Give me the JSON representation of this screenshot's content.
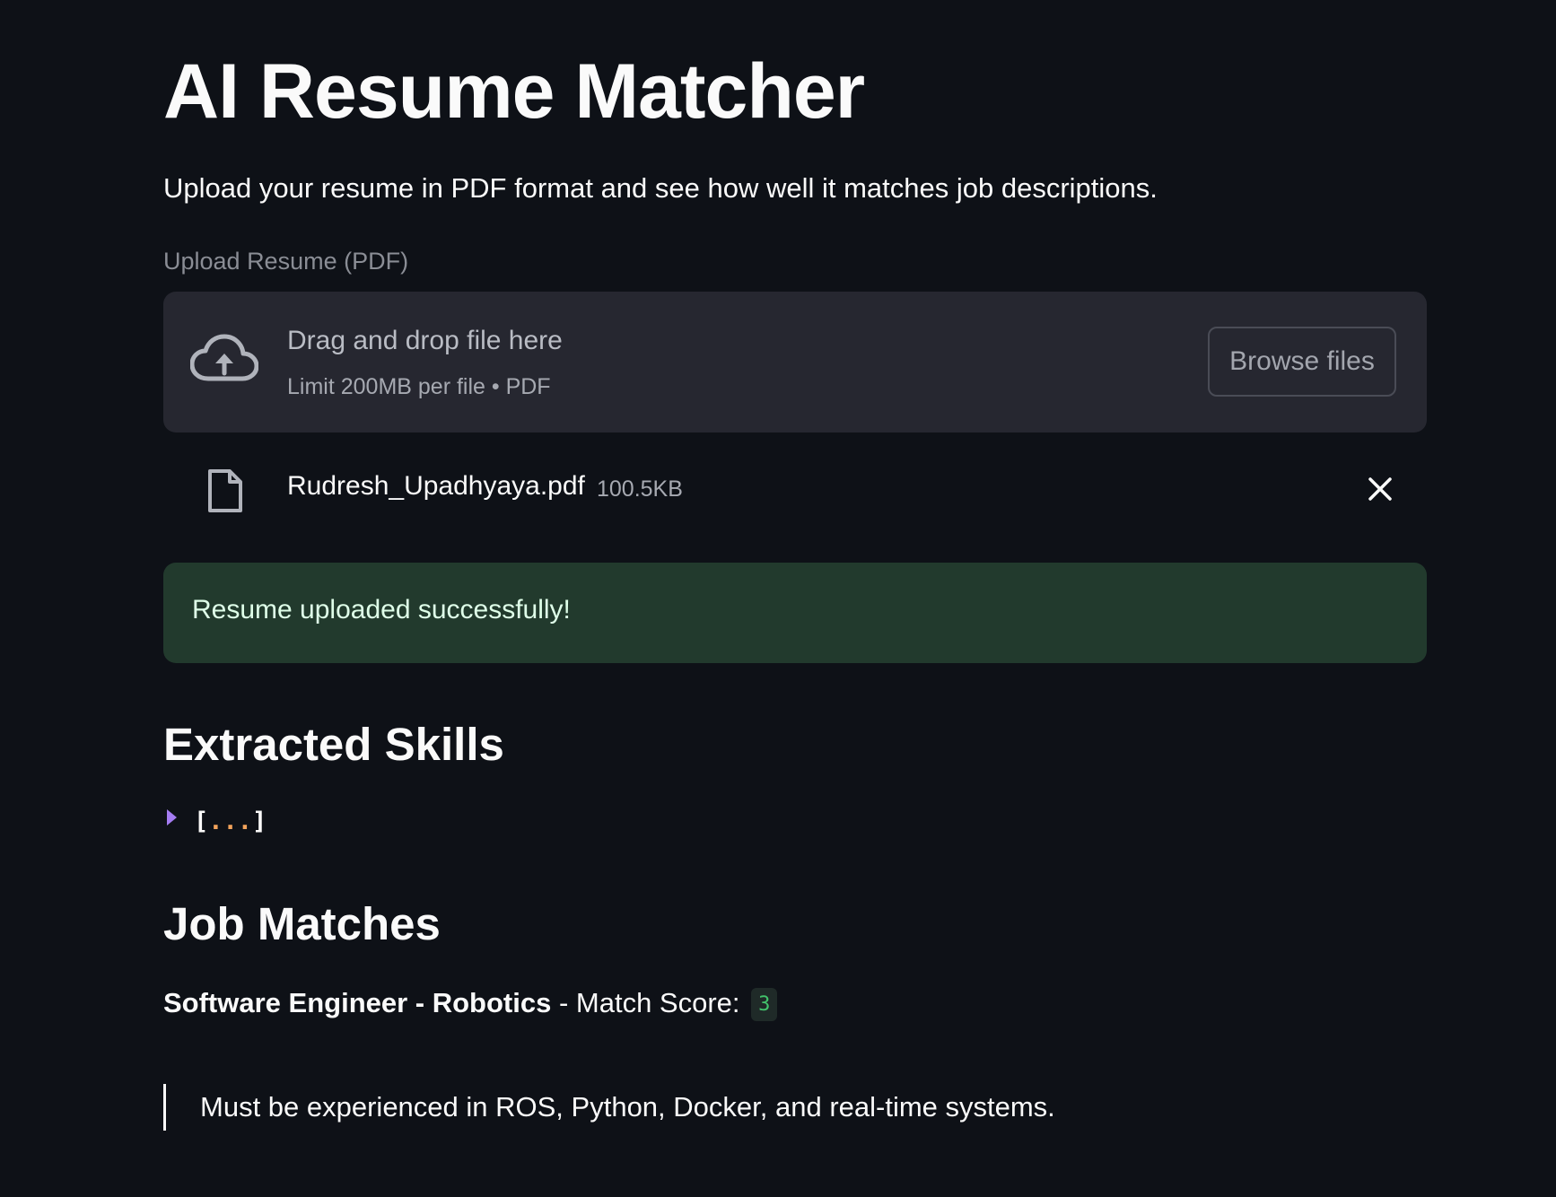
{
  "page": {
    "title": "AI Resume Matcher",
    "subtitle": "Upload your resume in PDF format and see how well it matches job descriptions."
  },
  "uploader": {
    "label": "Upload Resume (PDF)",
    "drop_text": "Drag and drop file here",
    "limit_text": "Limit 200MB per file • PDF",
    "browse_label": "Browse files",
    "icon": "cloud-upload-icon"
  },
  "uploaded_file": {
    "name": "Rudresh_Upadhyaya.pdf",
    "size": "100.5KB",
    "icon": "file-icon",
    "remove_icon": "close-icon"
  },
  "alert": {
    "text": "Resume uploaded successfully!",
    "color": "#223a2d"
  },
  "skills": {
    "heading": "Extracted Skills",
    "json_open": "[",
    "json_dots": "...",
    "json_close": "]"
  },
  "jobs": {
    "heading": "Job Matches",
    "items": [
      {
        "title": "Software Engineer - Robotics",
        "score_label": "- Match Score:",
        "score": "3",
        "description": "Must be experienced in ROS, Python, Docker, and real-time systems."
      }
    ]
  },
  "colors": {
    "background": "#0e1117",
    "accent_toggle": "#a47cf2",
    "score_text": "#42c36b"
  }
}
